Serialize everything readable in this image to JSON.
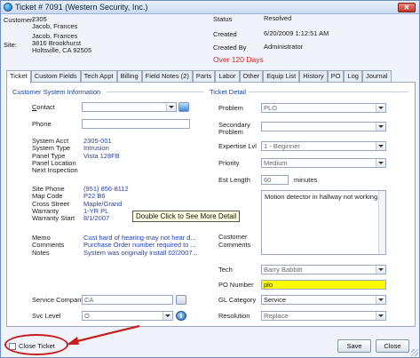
{
  "window": {
    "title": "Ticket # 7091  (Western Security, Inc.)",
    "close_glyph": "✕"
  },
  "header": {
    "customer_label": "Customer:",
    "customer_line1": "2305",
    "customer_line2": "Jacob, Frances",
    "site_label": "Site:",
    "site_line1": "Jacob, Frances",
    "site_line2": "3816 Brookhurst",
    "site_line3": "Holtsville, CA  92505",
    "status_label": "Status",
    "status_value": "Resolved",
    "created_label": "Created",
    "created_value": "6/20/2009 1:12:51 AM",
    "created_by_label": "Created By",
    "created_by_value": "Administrator",
    "overdue_text": "Over 120 Days"
  },
  "tabs": [
    "Ticket",
    "Custom Fields",
    "Tech Appt",
    "Billing",
    "Field Notes (2)",
    "Parts",
    "Labor",
    "Other",
    "Equip List",
    "History",
    "PO",
    "Log",
    "Journal"
  ],
  "left": {
    "section_title": "Customer System Information",
    "contact_label": "Contact",
    "phone_label": "Phone",
    "info_rows": [
      {
        "label": "System Acct",
        "value": "2305-001"
      },
      {
        "label": "System Type",
        "value": "Intrusion"
      },
      {
        "label": "Panel Type",
        "value": "Vista 128FB"
      },
      {
        "label": "Panel Location",
        "value": ""
      },
      {
        "label": "Next Inspection",
        "value": ""
      }
    ],
    "site_rows": [
      {
        "label": "Site Phone",
        "value": "(951) 856-8112"
      },
      {
        "label": "Map Code",
        "value": "P22 B6"
      },
      {
        "label": "Cross Street",
        "value": "Maple/Grand"
      },
      {
        "label": "Warranty",
        "value": "1-YR PL"
      },
      {
        "label": "Warranty Start",
        "value": "8/1/2007"
      }
    ],
    "memo_rows": [
      {
        "label": "Memo",
        "value": "Cust hard of hearing-may not hear d..."
      },
      {
        "label": "Comments",
        "value": "Purchase Order number required to ..."
      },
      {
        "label": "Notes",
        "value": "System was originally install 02/2007..."
      }
    ],
    "service_company_label": "Service Company",
    "service_company_value": "CA",
    "svc_level_label": "Svc Level",
    "svc_level_value": "O"
  },
  "right": {
    "section_title": "Ticket Detail",
    "problem_label": "Problem",
    "problem_value": "PLO",
    "secondary_label_1": "Secondary",
    "secondary_label_2": "Problem",
    "expertise_label": "Expertise Lvl",
    "expertise_value": "1 - Beginner",
    "priority_label": "Priority",
    "priority_value": "Medium",
    "est_length_label": "Est Length",
    "est_length_value": "60",
    "minutes_label": "minutes",
    "customer_comments_label_1": "Customer",
    "customer_comments_label_2": "Comments",
    "customer_comments_value": "Motion detector in hallway not working.",
    "tech_label": "Tech",
    "tech_value": "Barry Babbitt",
    "po_label": "PO Number",
    "po_value": "plo",
    "gl_label": "GL Category",
    "gl_value": "Service",
    "resolution_label": "Resolution",
    "resolution_value": "Replace"
  },
  "tooltip": "Double Click to See More Detail",
  "footer": {
    "close_ticket_label": "Close Ticket",
    "save_label": "Save",
    "close_label": "Close"
  },
  "colors": {
    "annotation": "#c81d1d",
    "po_highlight": "#ffff00",
    "overdue": "#e21b1b",
    "link_value": "#2742a8"
  }
}
